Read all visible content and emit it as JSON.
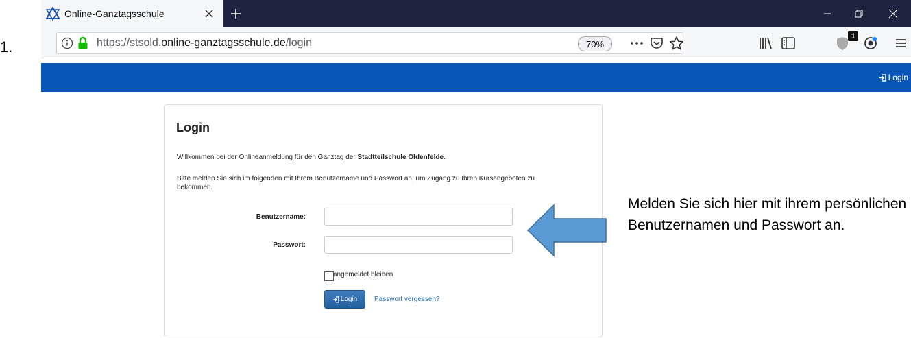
{
  "list_marker": "1.",
  "browser": {
    "tab_title": "Online-Ganztagsschule",
    "url_prefix": "https://stsold.",
    "url_domain": "online-ganztagsschule.de",
    "url_path": "/login",
    "zoom": "70%",
    "extension_badge": "1"
  },
  "header": {
    "login_label": "Login",
    "color": "#0a55b8"
  },
  "login": {
    "title": "Login",
    "welcome_text": "Willkommen bei der Onlineanmeldung für den Ganztag der ",
    "school_name": "Stadtteilschule Oldenfelde",
    "welcome_end": ".",
    "instructions": "Bitte melden Sie sich im folgenden mit Ihrem Benutzername und Passwort an, um Zugang zu Ihren Kursangeboten zu bekommen.",
    "username_label": "Benutzername:",
    "username_value": "",
    "password_label": "Passwort:",
    "password_value": "",
    "remember_label": "angemeldet bleiben",
    "submit_label": "Login",
    "forgot_label": "Passwort vergessen?"
  },
  "annotation": {
    "text": "Melden Sie sich hier mit ihrem persönlichen Benutzernamen und Passwort an.",
    "arrow_color": "#5b9bd5"
  },
  "icons": {
    "tab": "school-logo-icon",
    "info": "info-icon",
    "lock": "lock-icon"
  }
}
